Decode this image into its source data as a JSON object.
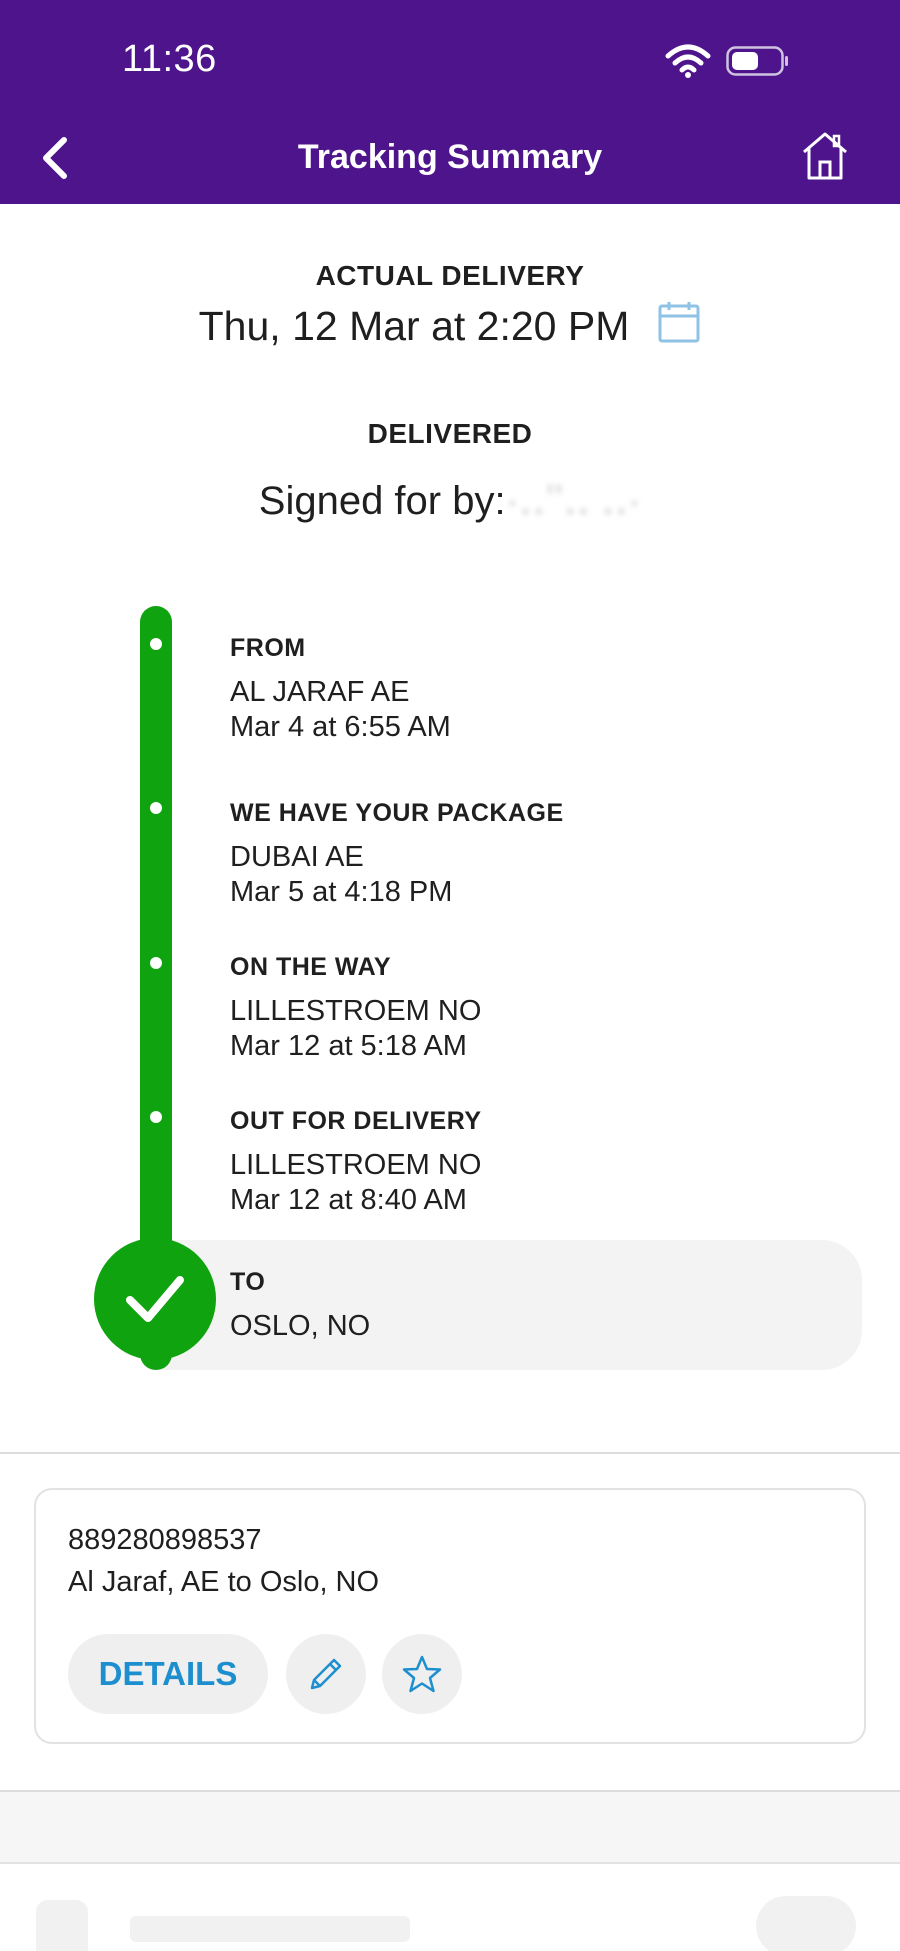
{
  "status_bar": {
    "time": "11:36"
  },
  "header": {
    "title": "Tracking Summary",
    "background_color": "#4d148c",
    "back_icon": "chevron-left-icon",
    "home_icon": "home-icon"
  },
  "delivery": {
    "label": "ACTUAL DELIVERY",
    "date_text": "Thu, 12 Mar at 2:20 PM",
    "calendar_icon": "calendar-icon"
  },
  "status": {
    "label": "DELIVERED",
    "signed_prefix": "Signed for by:",
    "signed_name": "·‥ʼʼ‥ ‥·"
  },
  "timeline": {
    "color": "#0fa30f",
    "stops": [
      {
        "label": "FROM",
        "line1": "AL JARAF AE",
        "line2": "Mar 4 at 6:55 AM"
      },
      {
        "label": "WE HAVE YOUR PACKAGE",
        "line1": "DUBAI AE",
        "line2": "Mar 5 at 4:18 PM"
      },
      {
        "label": "ON THE WAY",
        "line1": "LILLESTROEM NO",
        "line2": "Mar 12 at 5:18 AM"
      },
      {
        "label": "OUT FOR DELIVERY",
        "line1": "LILLESTROEM NO",
        "line2": "Mar 12 at 8:40 AM"
      },
      {
        "label": "TO",
        "line1": "OSLO, NO"
      }
    ]
  },
  "shipment_card": {
    "tracking_number": "889280898537",
    "route": "Al Jaraf, AE to Oslo, NO",
    "details_label": "DETAILS",
    "edit_icon": "pencil-icon",
    "star_icon": "star-icon",
    "accent_color": "#1e8fce"
  }
}
